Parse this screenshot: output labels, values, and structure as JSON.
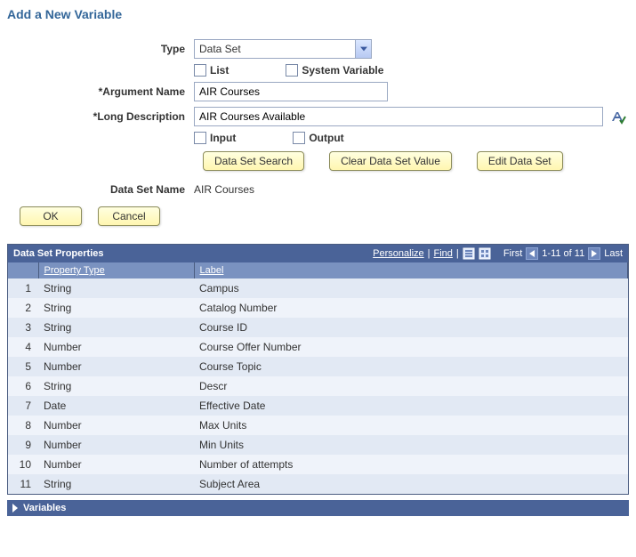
{
  "page_title": "Add a New Variable",
  "form": {
    "type_label": "Type",
    "type_value": "Data Set",
    "list_label": "List",
    "list_checked": false,
    "sysvar_label": "System Variable",
    "sysvar_checked": false,
    "argname_label": "*Argument Name",
    "argname_value": "AIR Courses",
    "longdesc_label": "*Long Description",
    "longdesc_value": "AIR Courses Available",
    "input_label": "Input",
    "input_checked": false,
    "output_label": "Output",
    "output_checked": false,
    "btn_search": "Data Set Search",
    "btn_clear": "Clear Data Set Value",
    "btn_edit": "Edit Data Set",
    "dsname_label": "Data Set Name",
    "dsname_value": "AIR Courses",
    "btn_ok": "OK",
    "btn_cancel": "Cancel"
  },
  "grid": {
    "title": "Data Set Properties",
    "personalize": "Personalize",
    "find": "Find",
    "first": "First",
    "last": "Last",
    "range": "1-11 of 11",
    "col_property_type": "Property Type",
    "col_label": "Label",
    "rows": [
      {
        "n": "1",
        "type": "String",
        "label": "Campus"
      },
      {
        "n": "2",
        "type": "String",
        "label": "Catalog Number"
      },
      {
        "n": "3",
        "type": "String",
        "label": "Course ID"
      },
      {
        "n": "4",
        "type": "Number",
        "label": "Course Offer Number"
      },
      {
        "n": "5",
        "type": "Number",
        "label": "Course Topic"
      },
      {
        "n": "6",
        "type": "String",
        "label": "Descr"
      },
      {
        "n": "7",
        "type": "Date",
        "label": "Effective Date"
      },
      {
        "n": "8",
        "type": "Number",
        "label": "Max Units"
      },
      {
        "n": "9",
        "type": "Number",
        "label": "Min Units"
      },
      {
        "n": "10",
        "type": "Number",
        "label": "Number of attempts"
      },
      {
        "n": "11",
        "type": "String",
        "label": "Subject Area"
      }
    ]
  },
  "variables_section": "Variables"
}
